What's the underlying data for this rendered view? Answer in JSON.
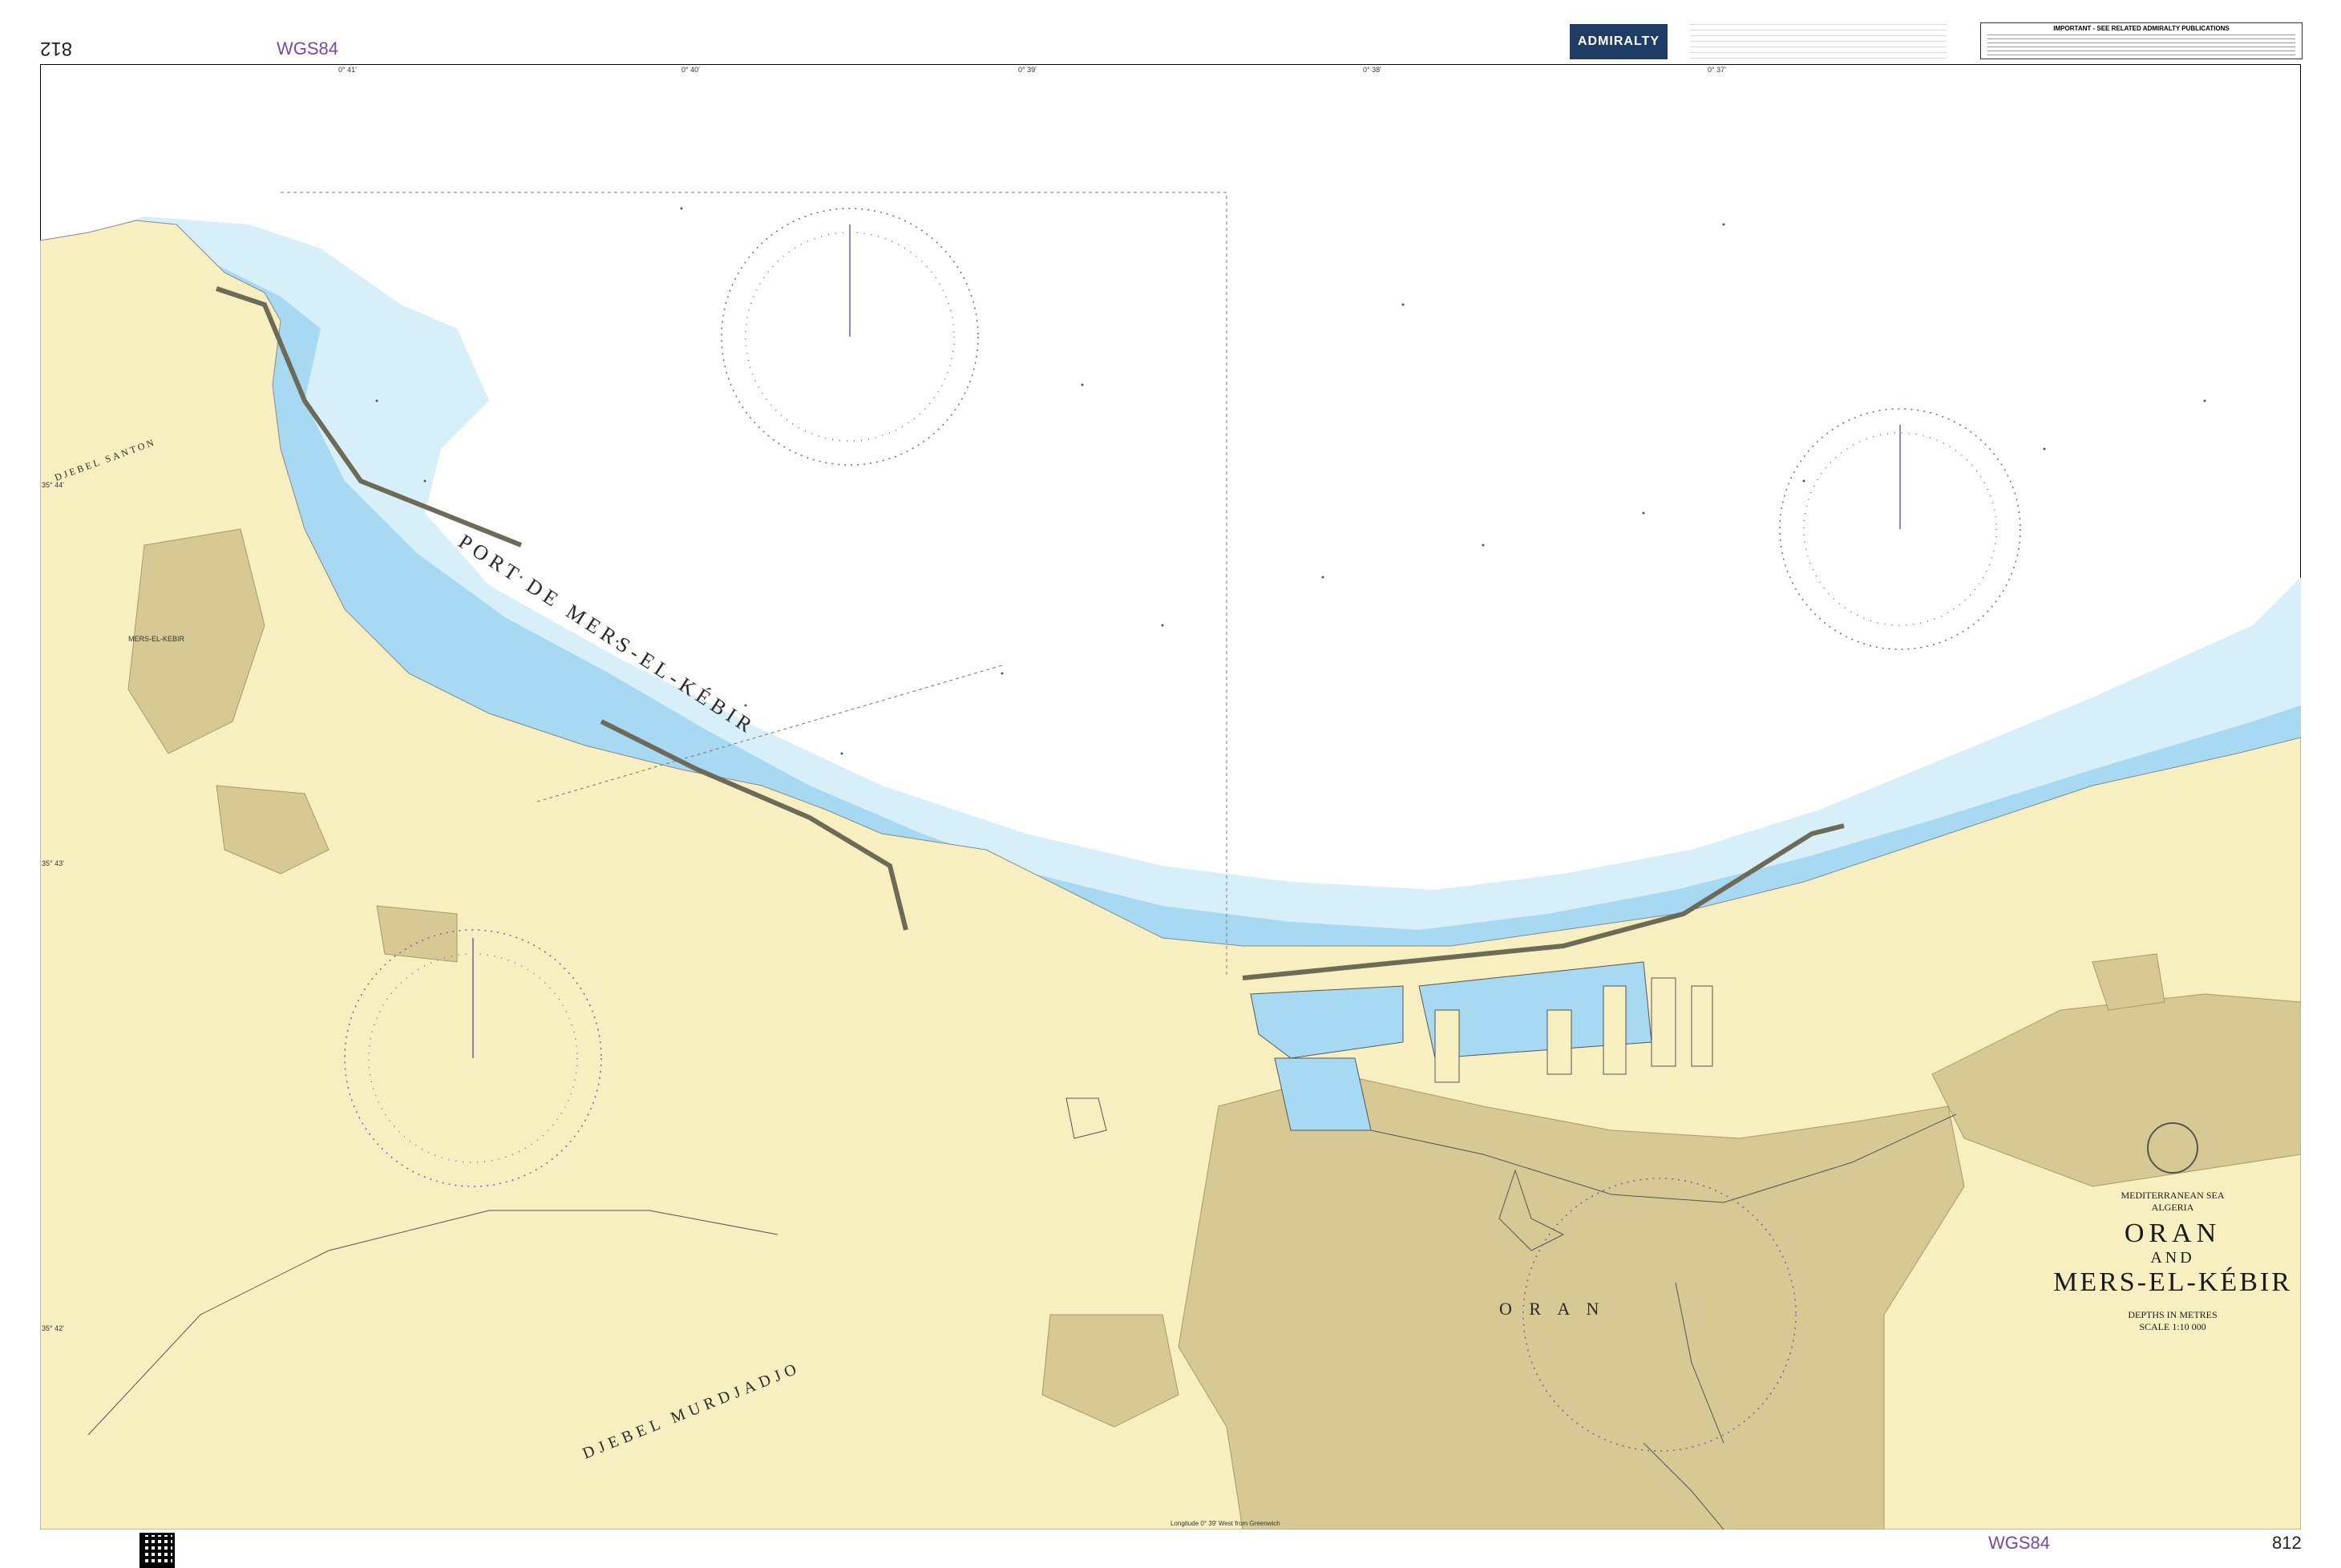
{
  "header": {
    "chart_number_top_rotated": "812",
    "datum_top": "WGS84",
    "brand": "ADMIRALTY",
    "important_notice": "IMPORTANT - SEE RELATED ADMIRALTY PUBLICATIONS"
  },
  "footer": {
    "datum_bottom": "WGS84",
    "chart_number_bottom": "812",
    "longitude_note": "Longitude 0° 39' West from Greenwich"
  },
  "title": {
    "region": "MEDITERRANEAN SEA",
    "country": "ALGERIA",
    "line1": "ORAN",
    "line2": "AND",
    "line3": "MERS-EL-KÉBIR",
    "depths": "DEPTHS IN METRES",
    "scale": "SCALE 1:10 000"
  },
  "map": {
    "features": {
      "port_label": "PORT DE MERS-EL-KÉBIR",
      "city_label": "O R A N",
      "town_label": "MERS-EL-KEBIR",
      "mountain_label": "DJEBEL MURDJADJO",
      "hill_label": "DJEBEL SANTON"
    },
    "latitude_labels": [
      "35° 44'",
      "35° 43'",
      "35° 42'"
    ],
    "longitude_labels": [
      "0° 41'",
      "0° 40'",
      "0° 39'",
      "0° 38'",
      "0° 37'"
    ],
    "colors": {
      "land": "#f8efc1",
      "built_up": "#d6c993",
      "shallow_water": "#a7d9f2",
      "mid_water": "#d7eff9",
      "deep_water": "#ffffff",
      "compass": "#7a5aa8",
      "frame": "#000000"
    }
  }
}
